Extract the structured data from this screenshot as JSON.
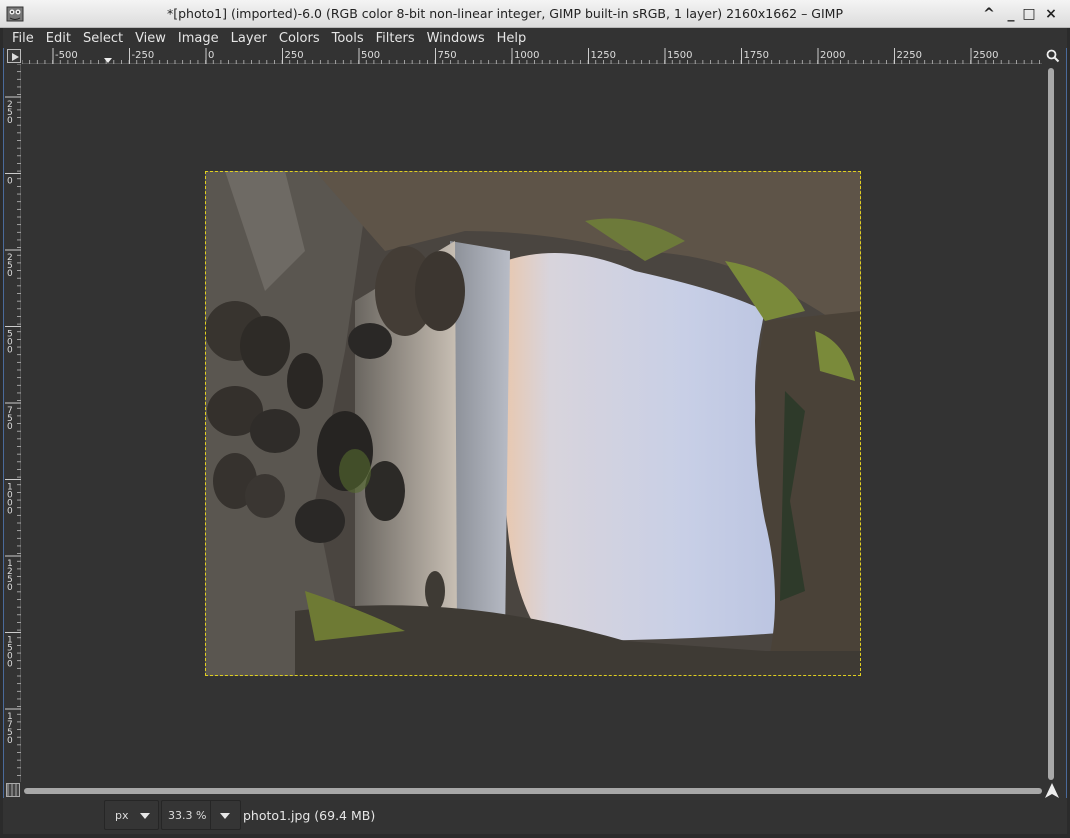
{
  "window": {
    "title": "*[photo1] (imported)-6.0 (RGB color 8-bit non-linear integer, GIMP built-in sRGB, 1 layer) 2160x1662 – GIMP",
    "controls": {
      "rollup": "^",
      "minimize": "_",
      "maximize": "□",
      "close": "×"
    }
  },
  "menu": {
    "items": [
      "File",
      "Edit",
      "Select",
      "View",
      "Image",
      "Layer",
      "Colors",
      "Tools",
      "Filters",
      "Windows",
      "Help"
    ]
  },
  "rulers": {
    "horizontal_labels": [
      "-500",
      "-250",
      "0",
      "250",
      "500",
      "750",
      "1000",
      "1250",
      "1500",
      "1750",
      "2000",
      "2250",
      "2500"
    ],
    "vertical_labels": [
      "250",
      "0",
      "250",
      "500",
      "750",
      "1000",
      "1250",
      "1500",
      "1750"
    ]
  },
  "statusbar": {
    "unit": "px",
    "zoom": "33.3 %",
    "file_info": "photo1.jpg (69.4 MB)"
  },
  "colors": {
    "canvas_bg": "#333333",
    "selection_marching_ants": "#e0d020",
    "frame_accent": "#4a6a9a"
  },
  "icons": {
    "app": "gimp-app-icon",
    "zoom_corner": "magnifier-icon",
    "navigate": "navigate-arrow-icon",
    "quickmask": "quick-mask-icon"
  }
}
